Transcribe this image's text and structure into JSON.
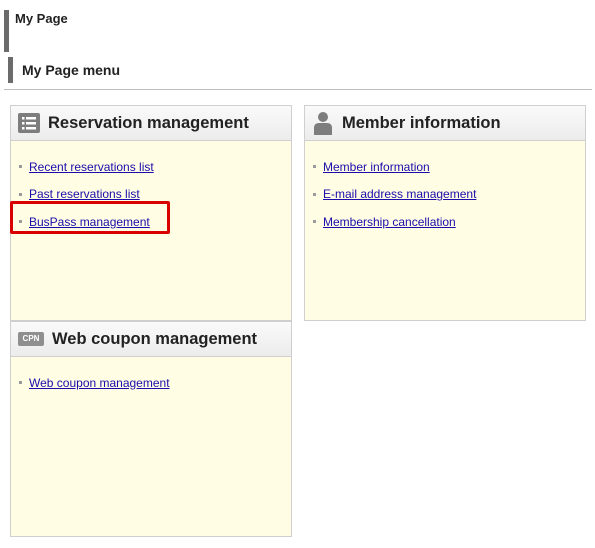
{
  "page": {
    "title": "My Page",
    "menu_title": "My Page menu"
  },
  "panels": {
    "reservation": {
      "title": "Reservation management",
      "icon": "list-icon",
      "links": [
        "Recent reservations list",
        "Past reservations list",
        "BusPass management"
      ]
    },
    "member": {
      "title": "Member information",
      "icon": "person-icon",
      "links": [
        "Member information",
        "E-mail address management",
        "Membership cancellation"
      ]
    },
    "coupon": {
      "title": "Web coupon management",
      "icon": "coupon-icon",
      "icon_text": "CPN",
      "links": [
        "Web coupon management"
      ]
    }
  },
  "colors": {
    "link": "#1a0dab",
    "panel_bg": "#fffde4",
    "highlight": "#d90000",
    "header_bar": "#6b6b6b"
  }
}
